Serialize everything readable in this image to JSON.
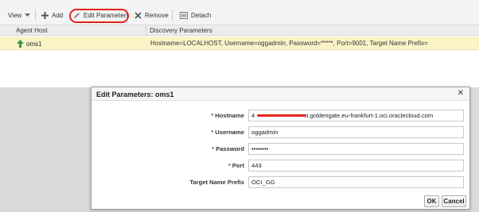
{
  "toolbar": {
    "view_label": "View",
    "add_label": "Add",
    "edit_label": "Edit Parameters",
    "remove_label": "Remove",
    "detach_label": "Detach"
  },
  "table": {
    "columns": [
      "Agent Host",
      "Discovery Parameters"
    ],
    "rows": [
      {
        "agent_host": "oms1",
        "discovery_parameters": "Hostname=LOCALHOST, Username=oggadmin, Password=*****, Port=9001, Target Name Prefix="
      }
    ]
  },
  "dialog": {
    "title": "Edit Parameters: oms1",
    "close_glyph": "✕",
    "fields": {
      "hostname": {
        "label": "Hostname",
        "value_prefix": "4",
        "value_suffix": "nt.goldengate.eu-frankfurt-1.oci.oraclecloud.com",
        "required": true
      },
      "username": {
        "label": "Username",
        "value": "oggadmin",
        "required": true
      },
      "password": {
        "label": "Password",
        "value": "••••••••",
        "required": true
      },
      "port": {
        "label": "Port",
        "value": "443",
        "required": true
      },
      "prefix": {
        "label": "Target Name Prefix",
        "value": "OCI_GG",
        "required": false
      }
    },
    "required_marker": "*",
    "ok_label": "OK",
    "cancel_label": "Cancel"
  },
  "colors": {
    "selected_row": "#fbf3c8",
    "highlight_annotation": "#e0241a",
    "required_marker": "#2a5db0",
    "agent_icon": "#2e9a3b"
  }
}
